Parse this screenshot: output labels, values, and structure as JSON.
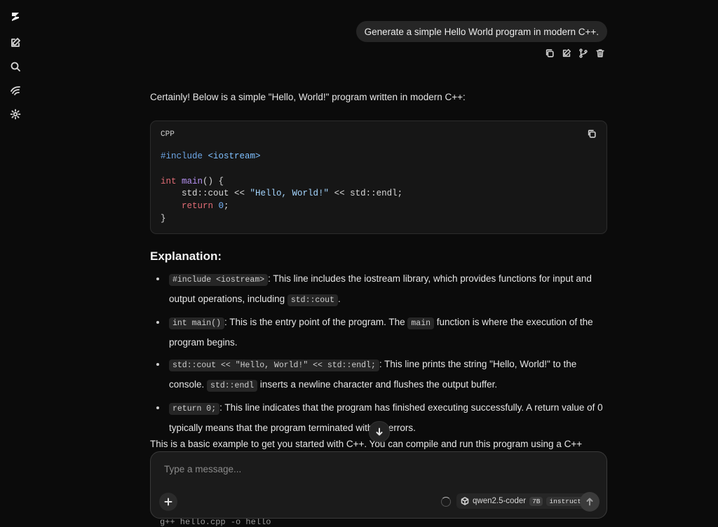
{
  "user_message": "Generate a simple Hello World program in modern C++.",
  "assistant": {
    "intro": "Certainly! Below is a simple \"Hello, World!\" program written in modern C++:",
    "code_block": {
      "language": "CPP",
      "lines": {
        "l1_pp": "#include",
        "l1_inc": " <iostream>",
        "l3_kw": "int",
        "l3_fn": " main",
        "l3_rest": "() {",
        "l4_pre": "    std::cout << ",
        "l4_str": "\"Hello, World!\"",
        "l4_post": " << std::endl;",
        "l5_kw": "    return",
        "l5_num": " 0",
        "l5_rest": ";",
        "l6": "}"
      }
    },
    "heading": "Explanation:",
    "bullets": [
      {
        "code": "#include <iostream>",
        "text": ": This line includes the iostream library, which provides functions for input and output operations, including ",
        "code2": "std::cout",
        "text2": "."
      },
      {
        "code": "int main()",
        "text": ": This is the entry point of the program. The ",
        "code2": "main",
        "text2": " function is where the execution of the program begins."
      },
      {
        "code": "std::cout << \"Hello, World!\" << std::endl;",
        "text": ": This line prints the string \"Hello, World!\" to the console. ",
        "code2": "std::endl",
        "text2": " inserts a newline character and flushes the output buffer."
      },
      {
        "code": "return 0;",
        "text": ": This line indicates that the program has finished executing successfully. A return value of 0 typically means that the program terminated without errors."
      }
    ],
    "outro": "This is a basic example to get you started with C++. You can compile and run this program using a C++",
    "trailing_code": "g++ hello.cpp -o hello"
  },
  "composer": {
    "placeholder": "Type a message...",
    "model_name": "qwen2.5-coder",
    "model_size": "7B",
    "model_variant": "instruct"
  }
}
